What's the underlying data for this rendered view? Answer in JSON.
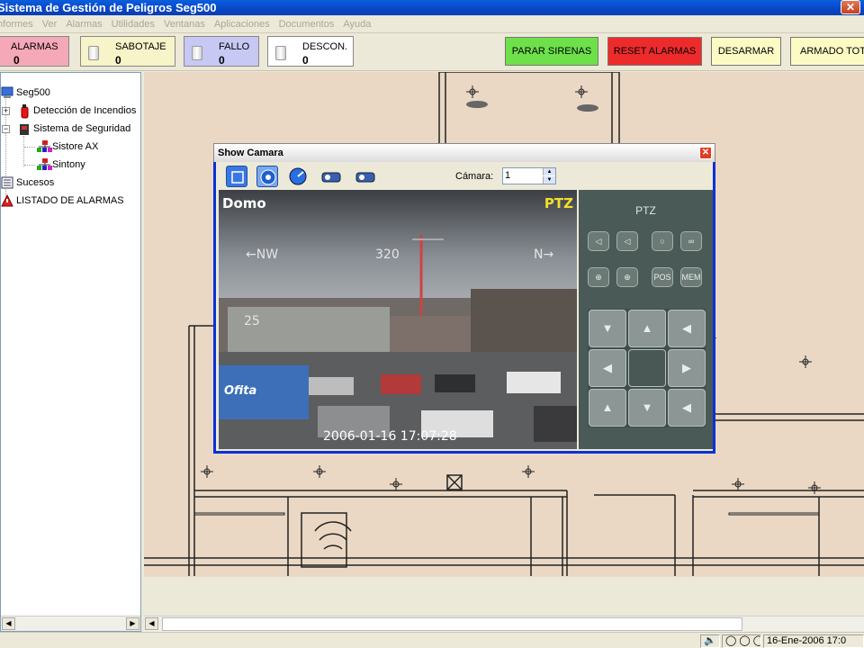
{
  "window": {
    "title": "Sistema de Gestión de Peligros Seg500",
    "close_icon": "close-icon"
  },
  "menu": [
    "Informes",
    "Ver",
    "Alarmas",
    "Utilidades",
    "Ventanas",
    "Aplicaciones",
    "Documentos",
    "Ayuda"
  ],
  "counters": {
    "alarmas": {
      "label": "ALARMAS",
      "count": "0",
      "color": "#f4a8b8"
    },
    "sabotaje": {
      "label": "SABOTAJE",
      "count": "0",
      "color": "#f6f4c8"
    },
    "fallo": {
      "label": "FALLO",
      "count": "0",
      "color": "#c8c8f4"
    },
    "descon": {
      "label": "DESCON.",
      "count": "0",
      "color": "#ffffff"
    }
  },
  "actions": {
    "parar": {
      "label": "PARAR SIRENAS",
      "color": "#6ee04a"
    },
    "reset": {
      "label": "RESET ALARMAS",
      "color": "#ee2b2b"
    },
    "desarmar": {
      "label": "DESARMAR",
      "color": "#fdfbc4"
    },
    "armado": {
      "label": "ARMADO TOTAL",
      "color": "#fdfbc4"
    }
  },
  "tree": {
    "root": "Seg500",
    "incendios": "Detección de Incendios",
    "seguridad": "Sistema de Seguridad",
    "sistore": "Sistore AX",
    "sintony": "Sintony",
    "sucesos": "Sucesos",
    "listado": "LISTADO DE ALARMAS"
  },
  "camera_dialog": {
    "title": "Show Camara",
    "camera_label": "Cámara:",
    "camera_value": "1",
    "overlay_name": "Domo",
    "overlay_mode": "PTZ",
    "overlay_compass_left": "←NW",
    "overlay_heading": "320",
    "overlay_compass_right": "N→",
    "overlay_tilt": "25",
    "overlay_timestamp": "2006-01-16 17:07:28",
    "overlay_sign": "Ofita",
    "ptz_title": "PTZ",
    "ptz_buttons": [
      "◁",
      "◁",
      "○",
      "∞",
      "⊕",
      "⊕",
      "POS",
      "MEM"
    ],
    "dpad": [
      "▼",
      "▲",
      "◀",
      "◀",
      "",
      "▶",
      "▲",
      "▼",
      "◀"
    ]
  },
  "status": {
    "speaker_icon": "speaker-icon",
    "datetime": "16-Ene-2006  17:0"
  }
}
